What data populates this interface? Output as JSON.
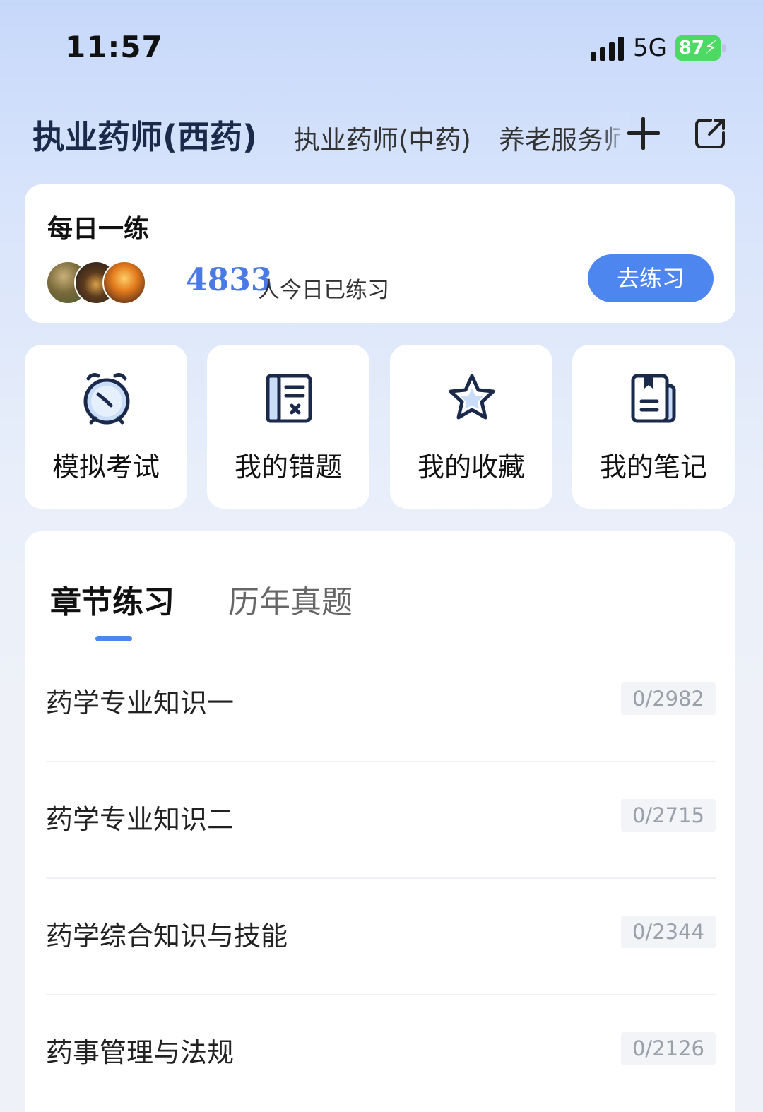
{
  "status_bar": {
    "time": "11:57",
    "network": "5G",
    "battery": "87"
  },
  "exam_tabs": {
    "active": "执业药师(西药)",
    "items": [
      "执业药师(中药)",
      "养老服务师"
    ]
  },
  "daily": {
    "title": "每日一练",
    "count": "4833",
    "count_text": "人今日已练习",
    "button_label": "去练习"
  },
  "quick_actions": [
    {
      "label": "模拟考试",
      "icon": "alarm-clock-icon"
    },
    {
      "label": "我的错题",
      "icon": "wrong-questions-book-icon"
    },
    {
      "label": "我的收藏",
      "icon": "star-icon"
    },
    {
      "label": "我的笔记",
      "icon": "notebook-icon"
    }
  ],
  "practice": {
    "tabs": [
      "章节练习",
      "历年真题"
    ],
    "active_tab": "章节练习",
    "items": [
      {
        "title": "药学专业知识一",
        "progress": "0/2982"
      },
      {
        "title": "药学专业知识二",
        "progress": "0/2715"
      },
      {
        "title": "药学综合知识与技能",
        "progress": "0/2344"
      },
      {
        "title": "药事管理与法规",
        "progress": "0/2126"
      }
    ]
  },
  "colors": {
    "accent": "#4d86ef",
    "count": "#4a7ae3",
    "battery": "#4cd964",
    "icon_stroke": "#1b2a4a",
    "icon_fill": "#c9dcf8"
  }
}
